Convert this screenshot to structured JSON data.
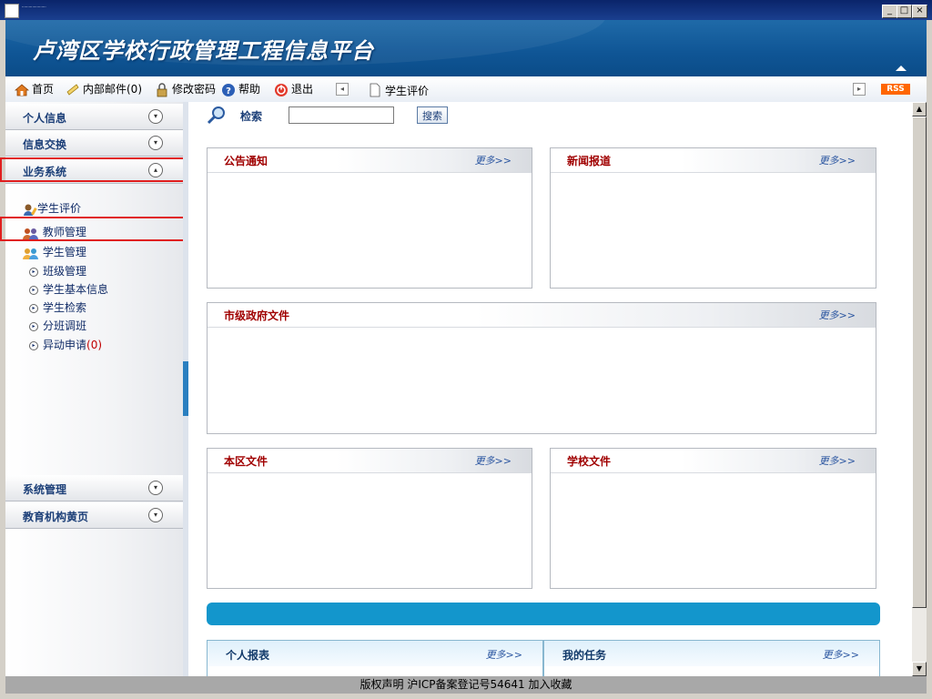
{
  "header": {
    "title": "卢湾区学校行政管理工程信息平台"
  },
  "toolbar": {
    "home": "首页",
    "mail": "内部邮件(0)",
    "password": "修改密码",
    "help": "帮助",
    "logout": "退出",
    "current_page": "学生评价",
    "rss": "RSS"
  },
  "sidebar": {
    "sections": [
      {
        "label": "个人信息"
      },
      {
        "label": "信息交换"
      },
      {
        "label": "业务系统"
      },
      {
        "label": "系统管理"
      },
      {
        "label": "教育机构黄页"
      }
    ],
    "items": [
      {
        "label": "学生评价"
      },
      {
        "label": "教师管理"
      },
      {
        "label": "学生管理"
      }
    ],
    "subitems": [
      {
        "label": "班级管理"
      },
      {
        "label": "学生基本信息"
      },
      {
        "label": "学生检索"
      },
      {
        "label": "分班调班"
      },
      {
        "label": "异动申请",
        "count": "(0)"
      }
    ]
  },
  "search": {
    "label": "检索",
    "button": "搜索",
    "value": ""
  },
  "panels": {
    "more": "更多>>",
    "notice": "公告通知",
    "news": "新闻报道",
    "city_docs": "市级政府文件",
    "district_docs": "本区文件",
    "school_docs": "学校文件",
    "personal_report": "个人报表",
    "my_tasks": "我的任务"
  },
  "footer": {
    "text": "版权声明 沪ICP备案登记号54641   加入收藏"
  },
  "colors": {
    "banner": "#0f5595",
    "panel_title": "#a00000",
    "accent": "#1396cc",
    "highlight_box": "#e01e1e"
  }
}
